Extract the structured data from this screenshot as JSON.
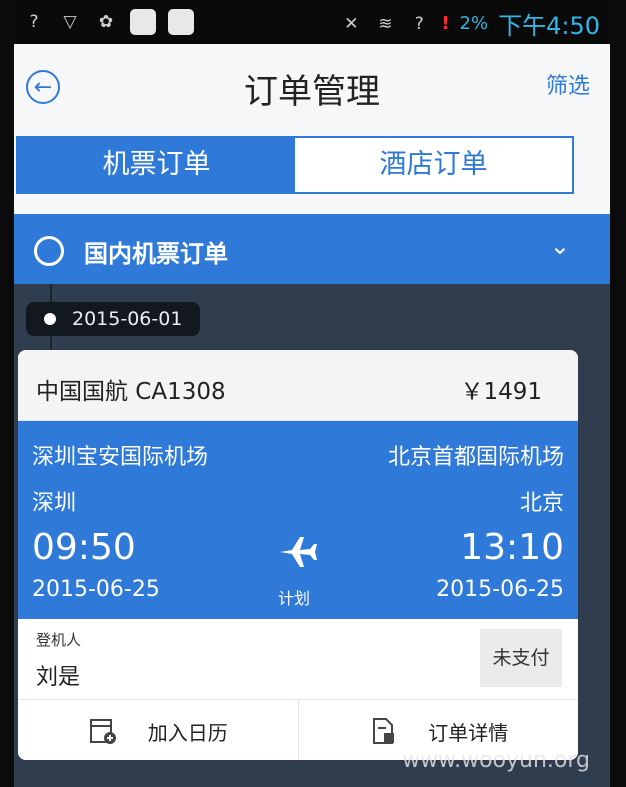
{
  "status_bar": {
    "battery": "2%",
    "time": "下午4:50"
  },
  "header": {
    "title": "订单管理",
    "filter": "筛选"
  },
  "tabs": [
    {
      "label": "机票订单",
      "active": true
    },
    {
      "label": "酒店订单",
      "active": false
    }
  ],
  "section": {
    "label": "国内机票订单"
  },
  "timeline": {
    "date": "2015-06-01"
  },
  "order": {
    "airline_flight": "中国国航 CA1308",
    "price": "￥1491",
    "departure": {
      "airport": "深圳宝安国际机场",
      "city": "深圳",
      "time": "09:50",
      "date": "2015-06-25"
    },
    "arrival": {
      "airport": "北京首都国际机场",
      "city": "北京",
      "time": "13:10",
      "date": "2015-06-25"
    },
    "status": "计划",
    "passenger_label": "登机人",
    "passenger_name": "刘是",
    "pay_status": "未支付",
    "actions": [
      {
        "label": "加入日历",
        "icon": "calendar-add-icon"
      },
      {
        "label": "订单详情",
        "icon": "document-icon"
      }
    ]
  },
  "watermark": "www.wooyun.org",
  "colors": {
    "accent": "#2f79d8",
    "background": "#2f3d4e"
  }
}
